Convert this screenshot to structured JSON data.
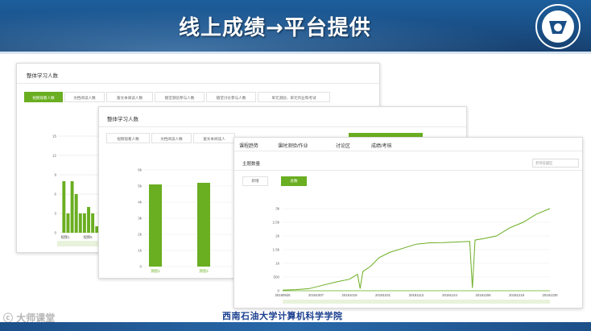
{
  "header": {
    "title": "线上成绩→平台提供"
  },
  "footer": {
    "school": "西南石油大学计算机科学学院",
    "watermark": "大师课堂"
  },
  "panel1": {
    "title": "整体学习人数",
    "tabs": [
      "视频观看人数",
      "文档阅读人数",
      "富文本阅读人数",
      "随堂测验参与人数",
      "随堂讨论参与人数",
      "单元测验、单元作业和考试"
    ],
    "chart_data": {
      "type": "bar",
      "y_ticks": [
        0,
        3,
        6,
        9,
        12,
        15
      ],
      "ylim": [
        0,
        16
      ],
      "categories": [
        "视频1",
        "",
        "",
        "",
        "",
        "",
        "",
        "",
        "视频5"
      ],
      "x_tick_labels": [
        "视频1",
        "视频5"
      ],
      "values": [
        8,
        3,
        8,
        6,
        3,
        3,
        4,
        3,
        1
      ]
    }
  },
  "panel2": {
    "title": "整体学习人数",
    "tabs": [
      "视频观看人数",
      "文档阅读人数",
      "富文本阅读人"
    ],
    "chart_data": {
      "type": "bar",
      "y_ticks": [
        "0",
        "1k",
        "2k",
        "3k",
        "4k",
        "5k",
        "6k"
      ],
      "ylim": [
        0,
        6000
      ],
      "categories": [
        "测验1",
        "测验2"
      ],
      "values": [
        5100,
        5200
      ]
    }
  },
  "panel3": {
    "nav": [
      "课程趋势",
      "课时测验/作业",
      "讨论区",
      "成绩/考核"
    ],
    "active_nav": "讨论区",
    "subtitle": "主题数量",
    "search_placeholder": "老师答疑区",
    "toggles": [
      "新增",
      "总数"
    ],
    "active_toggle": "总数",
    "accent": "#6aae21",
    "chart_data": {
      "type": "line",
      "y_ticks": [
        "0",
        "500",
        "1k",
        "1.5k",
        "2k",
        "2.5k",
        "3k"
      ],
      "ylim": [
        0,
        3000
      ],
      "x_tick_labels": [
        "20180925",
        "20181007",
        "20181019",
        "20181031",
        "20181112",
        "20181124",
        "20181206",
        "20181218",
        "20181230"
      ],
      "series": [
        {
          "x": [
            0,
            5,
            10,
            15,
            20,
            25,
            28,
            29,
            30,
            33,
            36,
            40,
            45,
            50,
            55,
            60,
            65,
            70,
            71,
            72,
            75,
            80,
            85,
            90,
            95,
            100
          ],
          "values": [
            20,
            40,
            80,
            200,
            320,
            420,
            600,
            80,
            700,
            900,
            1200,
            1400,
            1550,
            1700,
            1750,
            1760,
            1780,
            1800,
            100,
            1850,
            1900,
            2000,
            2300,
            2500,
            2800,
            3000
          ]
        }
      ]
    }
  }
}
